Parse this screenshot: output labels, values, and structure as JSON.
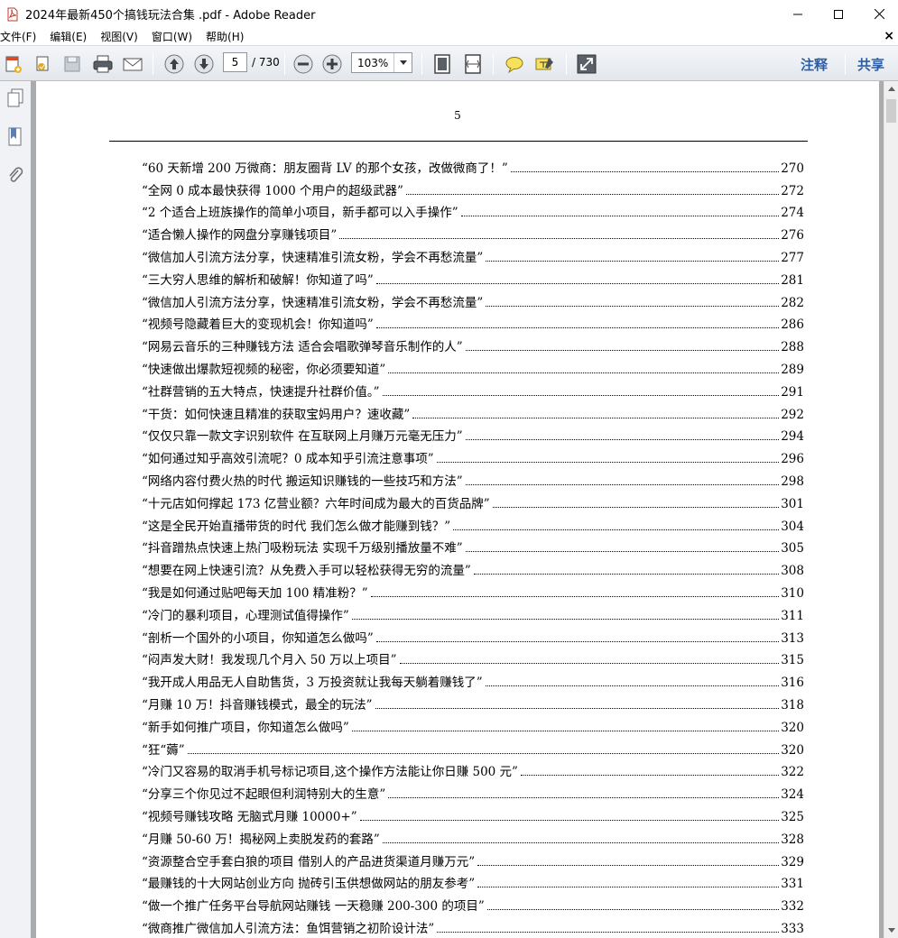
{
  "window": {
    "title": "2024年最新450个搞钱玩法合集 .pdf - Adobe Reader"
  },
  "menu": [
    {
      "label": "文件(F)"
    },
    {
      "label": "编辑(E)"
    },
    {
      "label": "视图(V)"
    },
    {
      "label": "窗口(W)"
    },
    {
      "label": "帮助(H)"
    }
  ],
  "toolbar": {
    "current_page": "5",
    "page_count": "/ 730",
    "zoom": "103%",
    "comment_label": "注释",
    "share_label": "共享"
  },
  "document": {
    "page_number": "5",
    "toc": [
      {
        "title": "“60 天新增 200 万微商：朋友圈背 LV 的那个女孩，改做微商了！”",
        "page": "270"
      },
      {
        "title": "“全网 0 成本最快获得 1000 个用户的超级武器”",
        "page": "272"
      },
      {
        "title": "“2 个适合上班族操作的简单小项目，新手都可以入手操作”",
        "page": "274"
      },
      {
        "title": "“适合懒人操作的网盘分享赚钱项目”",
        "page": "276"
      },
      {
        "title": "“微信加人引流方法分享，快速精准引流女粉，学会不再愁流量”",
        "page": "277"
      },
      {
        "title": "“三大穷人思维的解析和破解！你知道了吗”",
        "page": "281"
      },
      {
        "title": "“微信加人引流方法分享，快速精准引流女粉，学会不再愁流量”",
        "page": "282"
      },
      {
        "title": "“视频号隐藏着巨大的变现机会！你知道吗”",
        "page": "286"
      },
      {
        "title": "“网易云音乐的三种赚钱方法 适合会唱歌弹琴音乐制作的人”",
        "page": "288"
      },
      {
        "title": "“快速做出爆款短视频的秘密，你必须要知道”",
        "page": "289"
      },
      {
        "title": "“社群营销的五大特点，快速提升社群价值。”",
        "page": "291"
      },
      {
        "title": "“干货：如何快速且精准的获取宝妈用户？速收藏”",
        "page": "292"
      },
      {
        "title": "“仅仅只靠一款文字识别软件 在互联网上月赚万元毫无压力”",
        "page": "294"
      },
      {
        "title": "“如何通过知乎高效引流呢？0 成本知乎引流注意事项”",
        "page": "296"
      },
      {
        "title": "“网络内容付费火热的时代 搬运知识赚钱的一些技巧和方法”",
        "page": "298"
      },
      {
        "title": "“十元店如何撑起 173 亿营业额？六年时间成为最大的百货品牌”",
        "page": "301"
      },
      {
        "title": "“这是全民开始直播带货的时代 我们怎么做才能赚到钱？”",
        "page": "304"
      },
      {
        "title": "“抖音蹭热点快速上热门吸粉玩法 实现千万级别播放量不难”",
        "page": "305"
      },
      {
        "title": "“想要在网上快速引流？从免费入手可以轻松获得无穷的流量”",
        "page": "308"
      },
      {
        "title": "“我是如何通过贴吧每天加 100 精准粉？”",
        "page": "310"
      },
      {
        "title": "“冷门的暴利项目，心理测试值得操作”",
        "page": "311"
      },
      {
        "title": "“剖析一个国外的小项目，你知道怎么做吗”",
        "page": "313"
      },
      {
        "title": "“闷声发大财！我发现几个月入 50 万以上项目”",
        "page": "315"
      },
      {
        "title": "“我开成人用品无人自助售货，3 万投资就让我每天躺着赚钱了”",
        "page": "316"
      },
      {
        "title": "“月赚 10 万！抖音赚钱模式，最全的玩法”",
        "page": "318"
      },
      {
        "title": "“新手如何推广项目，你知道怎么做吗”",
        "page": "320"
      },
      {
        "title": "“狂“薅”",
        "page": "320"
      },
      {
        "title": "“冷门又容易的取消手机号标记项目,这个操作方法能让你日赚 500 元”",
        "page": "322"
      },
      {
        "title": "“分享三个你见过不起眼但利润特别大的生意”",
        "page": "324"
      },
      {
        "title": "“视频号赚钱攻略 无脑式月赚 10000+”",
        "page": "325"
      },
      {
        "title": "“月赚 50-60 万！揭秘网上卖脱发药的套路”",
        "page": "328"
      },
      {
        "title": "“资源整合空手套白狼的项目 借别人的产品进货渠道月赚万元”",
        "page": "329"
      },
      {
        "title": "“最赚钱的十大网站创业方向 抛砖引玉供想做网站的朋友参考”",
        "page": "331"
      },
      {
        "title": "“做一个推广任务平台导航网站赚钱 一天稳赚 200-300 的项目”",
        "page": "332"
      },
      {
        "title": "“微商推广微信加人引流方法：鱼饵营销之初阶设计法”",
        "page": "333"
      }
    ]
  }
}
